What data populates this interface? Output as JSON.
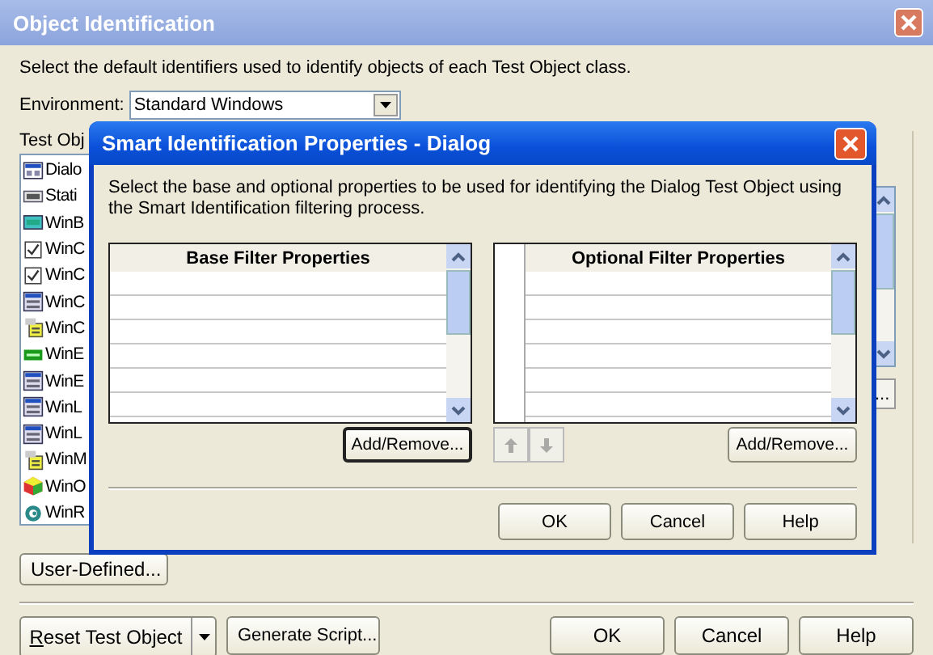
{
  "window": {
    "title": "Object Identification"
  },
  "description": "Select the default identifiers used to identify objects of each Test Object class.",
  "environment": {
    "label": "Environment:",
    "value": "Standard Windows"
  },
  "test_objects": {
    "label": "Test Obj",
    "items": [
      {
        "label": "Dialo"
      },
      {
        "label": "Stati"
      },
      {
        "label": "WinB"
      },
      {
        "label": "WinC"
      },
      {
        "label": "WinC"
      },
      {
        "label": "WinC"
      },
      {
        "label": "WinC"
      },
      {
        "label": "WinE"
      },
      {
        "label": "WinE"
      },
      {
        "label": "WinL"
      },
      {
        "label": "WinL"
      },
      {
        "label": "WinM"
      },
      {
        "label": "WinO"
      },
      {
        "label": "WinR"
      }
    ]
  },
  "user_defined_button": "User-Defined...",
  "side_button": "...",
  "dialog": {
    "title": "Smart Identification Properties - Dialog",
    "description": "Select the base and optional properties to be used for identifying the Dialog Test Object using the Smart Identification filtering process.",
    "base_filter": {
      "header": "Base Filter Properties",
      "button": "Add/Remove..."
    },
    "optional_filter": {
      "header": "Optional Filter Properties",
      "button": "Add/Remove..."
    },
    "order_buttons": [
      {
        "kind": "up",
        "disabled": true
      },
      {
        "kind": "down",
        "disabled": true
      }
    ],
    "buttons": [
      "OK",
      "Cancel",
      "Help"
    ]
  },
  "footer": {
    "reset_button": "Reset Test Object",
    "generate_button": "Generate Script...",
    "buttons": [
      "OK",
      "Cancel",
      "Help"
    ]
  }
}
